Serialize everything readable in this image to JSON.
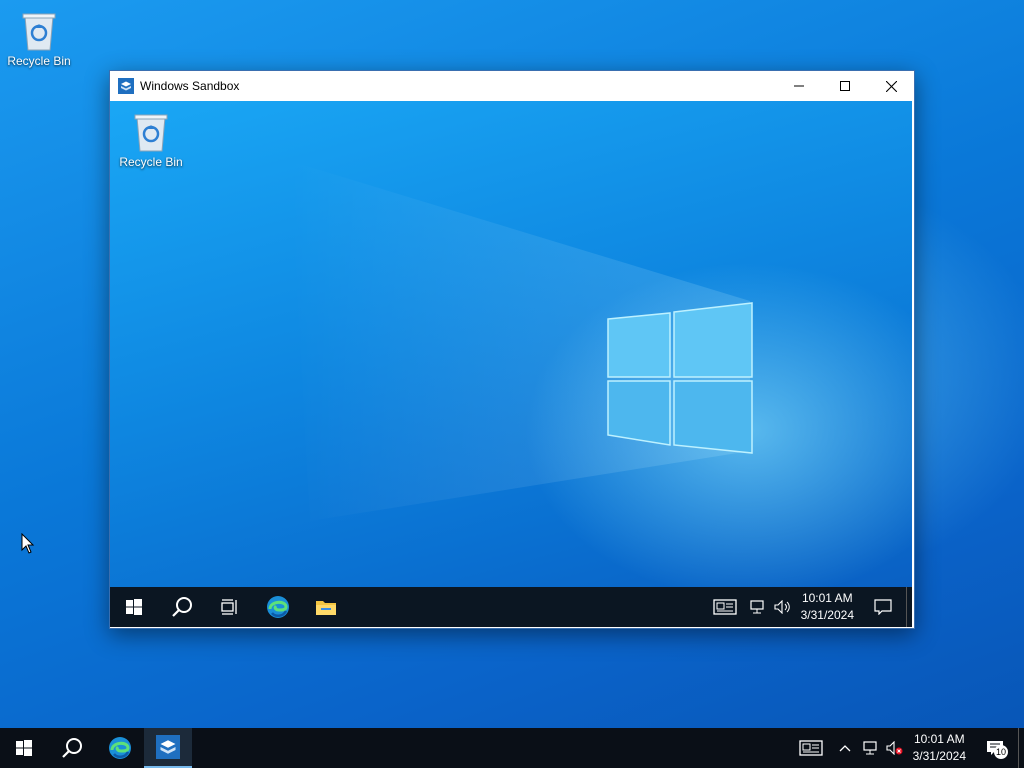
{
  "desktop": {
    "recycle_bin_label": "Recycle Bin"
  },
  "sandbox_window": {
    "title": "Windows Sandbox",
    "desktop": {
      "recycle_bin_label": "Recycle Bin"
    },
    "taskbar": {
      "time": "10:01 AM",
      "date": "3/31/2024"
    }
  },
  "taskbar": {
    "time": "10:01 AM",
    "date": "3/31/2024",
    "notification_count": "10"
  },
  "colors": {
    "taskbar": "#0a0f17",
    "accent": "#0078d7",
    "desktop": "#0a78d8"
  },
  "icons": [
    "recycle-bin-icon",
    "windows-sandbox-icon",
    "minimize-icon",
    "maximize-icon",
    "close-icon",
    "start-icon",
    "search-icon",
    "task-view-icon",
    "edge-icon",
    "file-explorer-icon",
    "news-icon",
    "network-icon",
    "volume-icon",
    "volume-muted-icon",
    "chevron-up-icon",
    "notification-icon",
    "mouse-pointer-icon"
  ]
}
